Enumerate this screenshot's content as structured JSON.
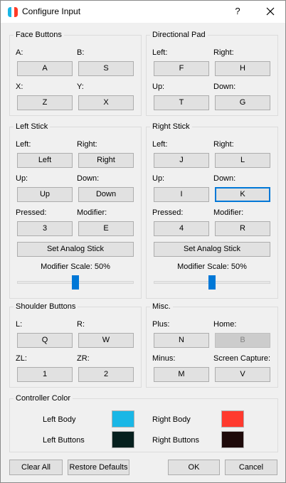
{
  "window": {
    "title": "Configure Input",
    "help": "?"
  },
  "face": {
    "title": "Face Buttons",
    "a_label": "A:",
    "a_value": "A",
    "b_label": "B:",
    "b_value": "S",
    "x_label": "X:",
    "x_value": "Z",
    "y_label": "Y:",
    "y_value": "X"
  },
  "dpad": {
    "title": "Directional Pad",
    "left_label": "Left:",
    "left_value": "F",
    "right_label": "Right:",
    "right_value": "H",
    "up_label": "Up:",
    "up_value": "T",
    "down_label": "Down:",
    "down_value": "G"
  },
  "lstick": {
    "title": "Left Stick",
    "left_label": "Left:",
    "left_value": "Left",
    "right_label": "Right:",
    "right_value": "Right",
    "up_label": "Up:",
    "up_value": "Up",
    "down_label": "Down:",
    "down_value": "Down",
    "pressed_label": "Pressed:",
    "pressed_value": "3",
    "modifier_label": "Modifier:",
    "modifier_value": "E",
    "analog_button": "Set Analog Stick",
    "scale_label": "Modifier Scale: 50%",
    "scale_fraction": 0.5
  },
  "rstick": {
    "title": "Right Stick",
    "left_label": "Left:",
    "left_value": "J",
    "right_label": "Right:",
    "right_value": "L",
    "up_label": "Up:",
    "up_value": "I",
    "down_label": "Down:",
    "down_value": "K",
    "pressed_label": "Pressed:",
    "pressed_value": "4",
    "modifier_label": "Modifier:",
    "modifier_value": "R",
    "analog_button": "Set Analog Stick",
    "scale_label": "Modifier Scale: 50%",
    "scale_fraction": 0.5
  },
  "shoulder": {
    "title": "Shoulder Buttons",
    "l_label": "L:",
    "l_value": "Q",
    "r_label": "R:",
    "r_value": "W",
    "zl_label": "ZL:",
    "zl_value": "1",
    "zr_label": "ZR:",
    "zr_value": "2"
  },
  "misc": {
    "title": "Misc.",
    "plus_label": "Plus:",
    "plus_value": "N",
    "home_label": "Home:",
    "home_value": "B",
    "minus_label": "Minus:",
    "minus_value": "M",
    "capture_label": "Screen Capture:",
    "capture_value": "V"
  },
  "color": {
    "title": "Controller Color",
    "left_body_label": "Left Body",
    "left_buttons_label": "Left Buttons",
    "right_body_label": "Right Body",
    "right_buttons_label": "Right Buttons",
    "left_body": "#1ab7e6",
    "left_buttons": "#06201e",
    "right_body": "#ff3a2e",
    "right_buttons": "#1e0a0a"
  },
  "footer": {
    "clear_all": "Clear All",
    "restore_defaults": "Restore Defaults",
    "ok": "OK",
    "cancel": "Cancel"
  },
  "colors": {
    "accent": "#0078d7"
  }
}
